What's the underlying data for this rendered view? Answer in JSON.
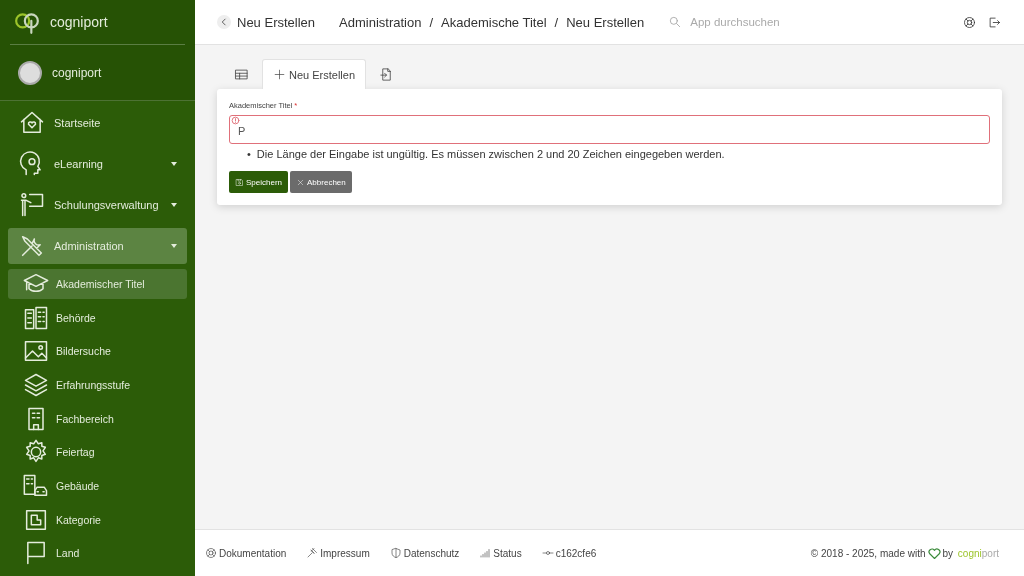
{
  "sidebar": {
    "brand": "cogniport",
    "user": "cogniport",
    "items": [
      {
        "label": "Startseite",
        "expandable": false,
        "expanded": false
      },
      {
        "label": "eLearning",
        "expandable": true,
        "expanded": false
      },
      {
        "label": "Schulungsverwaltung",
        "expandable": true,
        "expanded": false
      },
      {
        "label": "Administration",
        "expandable": true,
        "expanded": true,
        "children": [
          {
            "label": "Akademischer Titel",
            "selected": true
          },
          {
            "label": "Behörde",
            "selected": false
          },
          {
            "label": "Bildersuche",
            "selected": false
          },
          {
            "label": "Erfahrungsstufe",
            "selected": false
          },
          {
            "label": "Fachbereich",
            "selected": false
          },
          {
            "label": "Feiertag",
            "selected": false
          },
          {
            "label": "Gebäude",
            "selected": false
          },
          {
            "label": "Kategorie",
            "selected": false
          },
          {
            "label": "Land",
            "selected": false
          }
        ]
      }
    ]
  },
  "header": {
    "back": "Neu Erstellen",
    "breadcrumbs": [
      "Administration",
      "Akademische Titel",
      "Neu Erstellen"
    ],
    "separator": "/",
    "search": {
      "placeholder": "App durchsuchen"
    }
  },
  "tabs": [
    {
      "kind": "table",
      "selected": false
    },
    {
      "kind": "create",
      "label": "Neu Erstellen",
      "selected": true
    },
    {
      "kind": "import",
      "selected": false
    }
  ],
  "form": {
    "label": "Akademischer Titel",
    "required": "*",
    "value": "P",
    "invalid": true,
    "bullet": "•",
    "errors": [
      "Die Länge der Eingabe ist ungültig. Es müssen zwischen 2 und 20 Zeichen eingegeben werden."
    ],
    "buttons": [
      {
        "kind": "primary",
        "label": "Speichern"
      },
      {
        "kind": "secondary",
        "label": "Abbrechen"
      }
    ]
  },
  "footer": {
    "links": [
      {
        "kind": "docs",
        "label": "Dokumentation"
      },
      {
        "kind": "legal",
        "label": "Impressum"
      },
      {
        "kind": "privacy",
        "label": "Datenschutz"
      },
      {
        "kind": "status",
        "label": "Status"
      },
      {
        "kind": "commit",
        "label": "c162cfe6"
      }
    ],
    "copyright": "© 2018 - 2025, made with",
    "by": "by",
    "brand_a": "cogni",
    "brand_b": "port"
  }
}
